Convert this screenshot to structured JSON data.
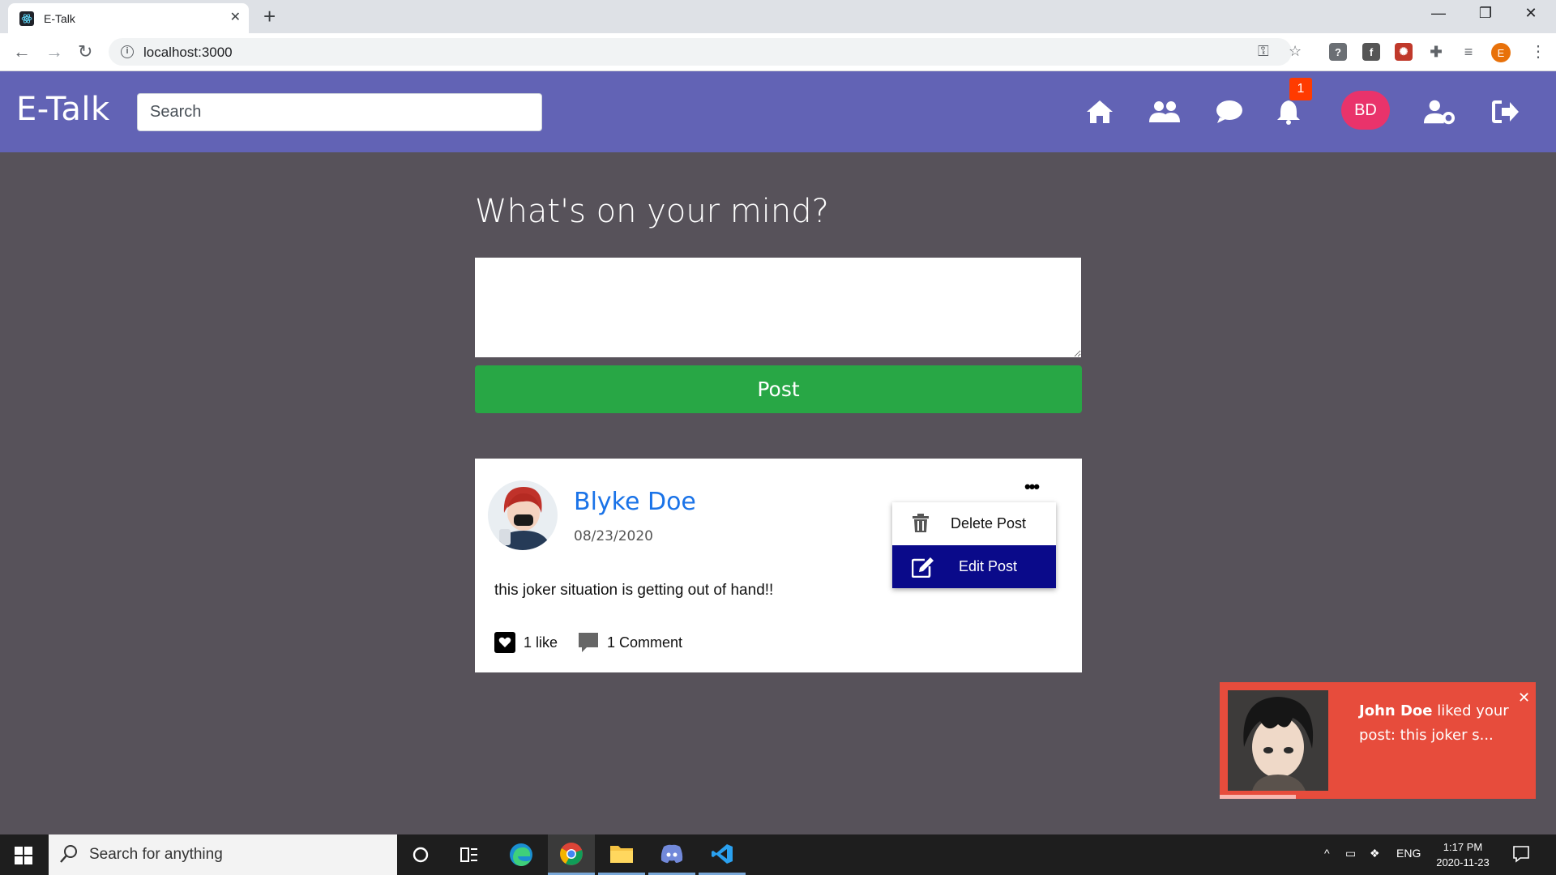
{
  "browser": {
    "tab_title": "E-Talk",
    "tab_close": "✕",
    "new_tab": "+",
    "url": "localhost:3000",
    "window_controls": [
      "—",
      "❐",
      "✕"
    ],
    "profile_initial": "E"
  },
  "navbar": {
    "brand": "E-Talk",
    "search_placeholder": "Search",
    "notification_count": "1",
    "user_initials": "BD",
    "icons": [
      "home-icon",
      "friends-icon",
      "chat-icon",
      "bell-icon",
      "user-settings-icon",
      "logout-icon"
    ]
  },
  "composer": {
    "heading": "What's on your mind?",
    "post_button": "Post"
  },
  "post": {
    "author": "Blyke Doe",
    "date": "08/23/2020",
    "body": "this joker situation is getting out of hand!!",
    "more": "•••",
    "likes": "1 like",
    "comments": "1 Comment",
    "menu": {
      "delete_label": "Delete Post",
      "edit_label": "Edit Post"
    }
  },
  "toast": {
    "actor": "John Doe",
    "message": " liked your post: this joker s...",
    "close": "✕",
    "progress": 0.24
  },
  "taskbar": {
    "search_placeholder": "Search for anything",
    "language": "ENG",
    "time": "1:17 PM",
    "date": "2020-11-23"
  },
  "colors": {
    "navbar": "#6263b5",
    "background": "#57525a",
    "post_button": "#28a745",
    "author_link": "#1a73e8",
    "edit_item": "#0a0a8a",
    "toast": "#e74c3c",
    "avatar": "#e9336b"
  }
}
